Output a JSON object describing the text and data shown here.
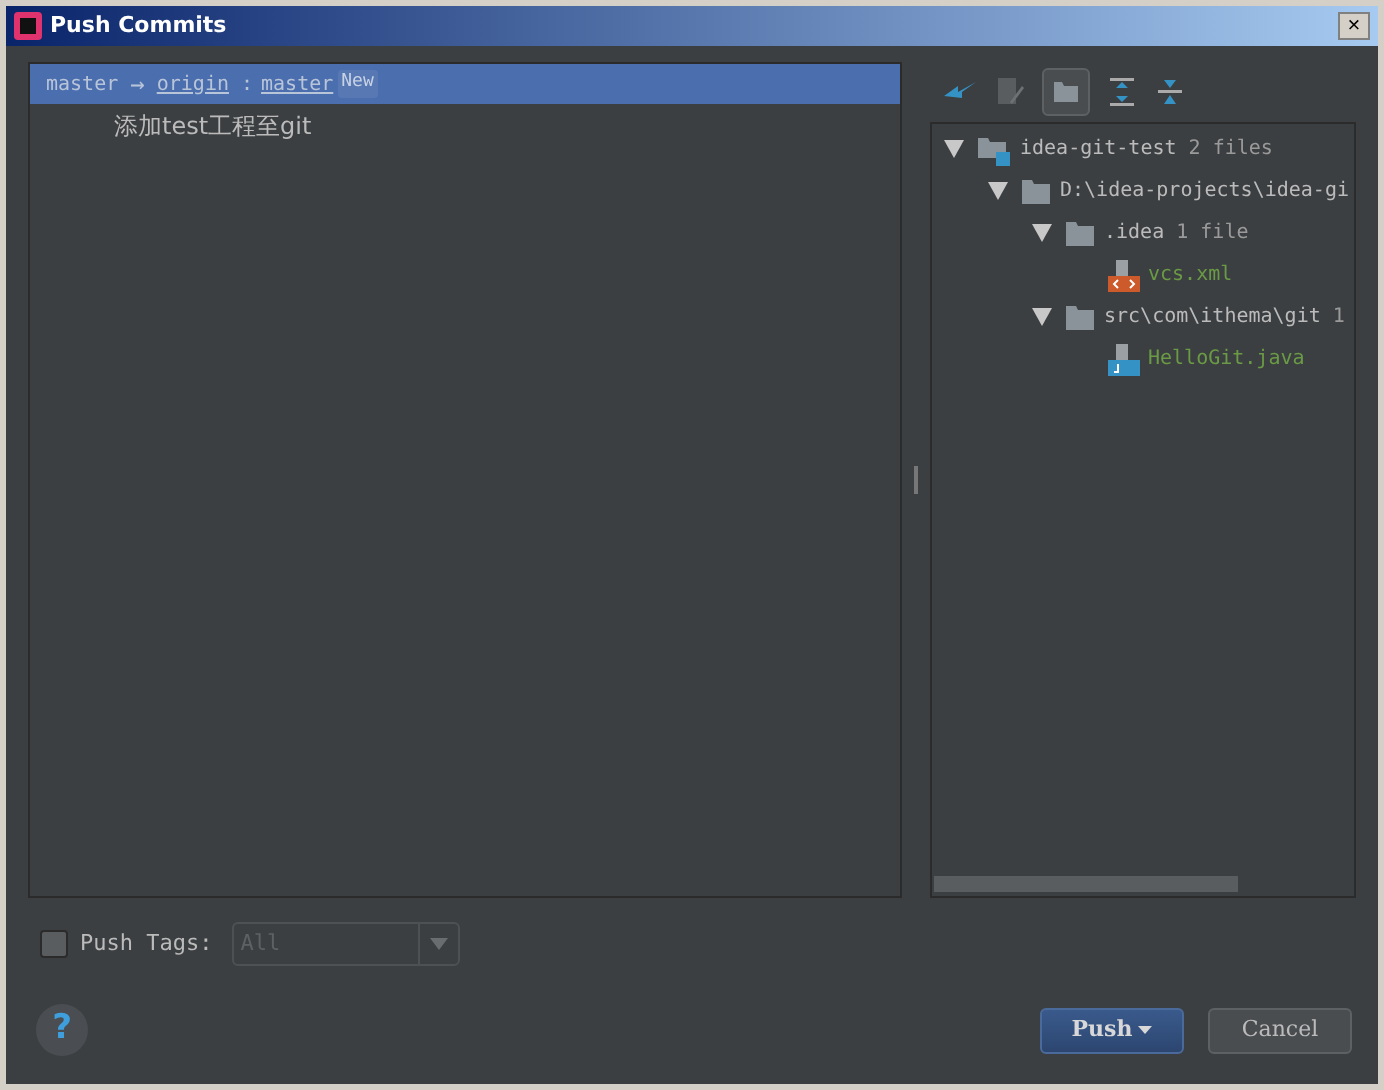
{
  "window": {
    "title": "Push Commits",
    "close": "×"
  },
  "branch_row": {
    "source": "master",
    "arrow": "→",
    "remote": "origin",
    "separator": ":",
    "target": "master",
    "badge": "New",
    "selected": true
  },
  "commits": [
    {
      "message": "添加test工程至git"
    }
  ],
  "tree": [
    {
      "kind": "module",
      "label": "idea-git-test",
      "detail": "2 files",
      "expanded": true,
      "children": [
        {
          "kind": "folder",
          "label": "D:\\idea-projects\\idea-gi",
          "expanded": true,
          "children": [
            {
              "kind": "folder",
              "label": ".idea",
              "detail": "1 file",
              "expanded": true,
              "children": [
                {
                  "kind": "xml",
                  "label": "vcs.xml"
                }
              ]
            },
            {
              "kind": "folder",
              "label": "src\\com\\ithema\\git",
              "detail": "1",
              "expanded": true,
              "children": [
                {
                  "kind": "java",
                  "label": "HelloGit.java"
                }
              ]
            }
          ]
        }
      ]
    }
  ],
  "push_tags": {
    "label": "Push Tags:",
    "checked": false,
    "value": "All",
    "disabled": true
  },
  "help": "?",
  "buttons": [
    {
      "kind": "primary",
      "label": "Push",
      "caret": true
    },
    {
      "kind": "secondary",
      "label": "Cancel"
    }
  ]
}
